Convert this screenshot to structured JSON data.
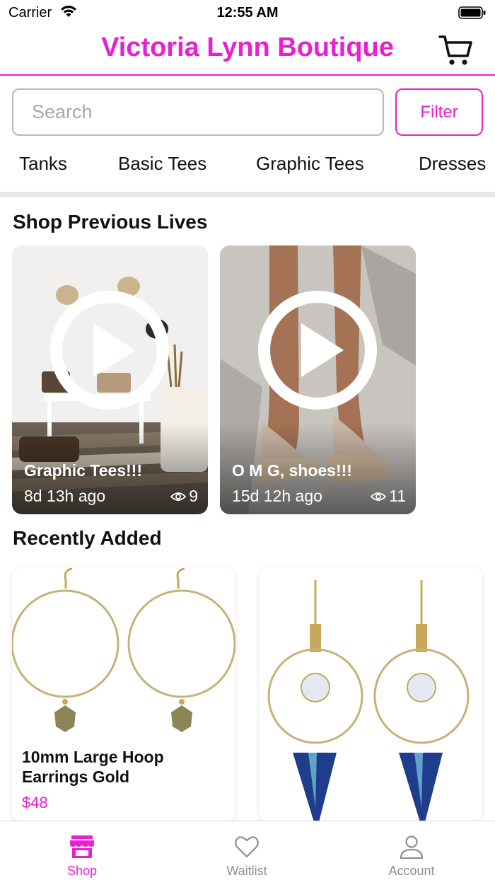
{
  "status_bar": {
    "carrier": "Carrier",
    "time": "12:55 AM"
  },
  "header": {
    "title": "Victoria Lynn Boutique",
    "cart_icon": "cart-icon"
  },
  "search": {
    "placeholder": "Search",
    "value": "",
    "filter_label": "Filter"
  },
  "categories": [
    "Tanks",
    "Basic Tees",
    "Graphic Tees",
    "Dresses"
  ],
  "sections": {
    "previous_lives": "Shop Previous Lives",
    "recently_added": "Recently Added"
  },
  "lives": [
    {
      "title": "Graphic Tees!!!",
      "age": "8d 13h ago",
      "views": "9"
    },
    {
      "title": "O M G, shoes!!!",
      "age": "15d 12h ago",
      "views": "11"
    }
  ],
  "products": [
    {
      "name": "10mm Large Hoop Earrings Gold",
      "price": "$48"
    },
    {
      "name": "",
      "price": ""
    }
  ],
  "tab_bar": {
    "active": "Shop",
    "items": [
      {
        "label": "Shop",
        "icon": "store-icon"
      },
      {
        "label": "Waitlist",
        "icon": "heart-icon"
      },
      {
        "label": "Account",
        "icon": "person-icon"
      }
    ]
  },
  "colors": {
    "accent": "#e91fd0",
    "inactive": "#8e8e8e",
    "divider": "#e8e8e8"
  }
}
